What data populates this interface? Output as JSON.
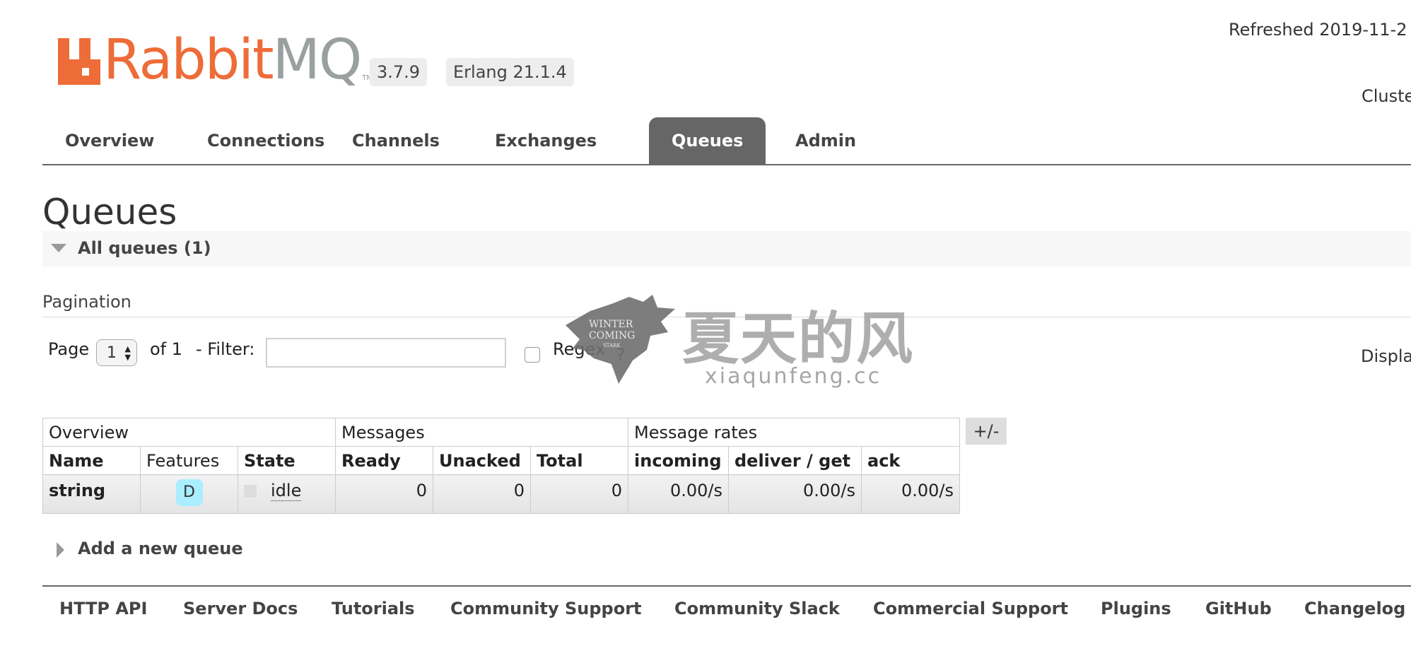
{
  "header": {
    "logo_text_orange": "Rabbit",
    "logo_text_gray": "MQ",
    "logo_tm": "TM",
    "version": "3.7.9",
    "erlang": "Erlang 21.1.4",
    "refreshed": "Refreshed 2019-11-2",
    "cluster": "Cluste"
  },
  "tabs": [
    {
      "label": "Overview"
    },
    {
      "label": "Connections"
    },
    {
      "label": "Channels"
    },
    {
      "label": "Exchanges"
    },
    {
      "label": "Queues",
      "active": true
    },
    {
      "label": "Admin"
    }
  ],
  "page": {
    "title": "Queues",
    "section_label": "All queues (1)",
    "pagination_label": "Pagination",
    "page_label": "Page",
    "page_value": "1",
    "of_label": "of 1",
    "filter_label": "- Filter:",
    "filter_value": "",
    "regex_label": "Regex",
    "help": "?",
    "displaying": "Displa"
  },
  "table": {
    "groups": [
      "Overview",
      "Messages",
      "Message rates"
    ],
    "columns": [
      "Name",
      "Features",
      "State",
      "Ready",
      "Unacked",
      "Total",
      "incoming",
      "deliver / get",
      "ack"
    ],
    "rows": [
      {
        "name": "string",
        "feature": "D",
        "state": "idle",
        "ready": "0",
        "unacked": "0",
        "total": "0",
        "incoming": "0.00/s",
        "deliver_get": "0.00/s",
        "ack": "0.00/s"
      }
    ],
    "plusminus": "+/-"
  },
  "add_queue": "Add a new queue",
  "footer": [
    "HTTP API",
    "Server Docs",
    "Tutorials",
    "Community Support",
    "Community Slack",
    "Commercial Support",
    "Plugins",
    "GitHub",
    "Changelog"
  ],
  "watermark": {
    "title": "夏天的风",
    "url": "xiaqunfeng.cc",
    "emblem_text": "WINTER COMING STARK"
  },
  "colors": {
    "brand": "#ee6c38",
    "tab_active": "#666666",
    "feature_badge": "#aaeeff"
  }
}
